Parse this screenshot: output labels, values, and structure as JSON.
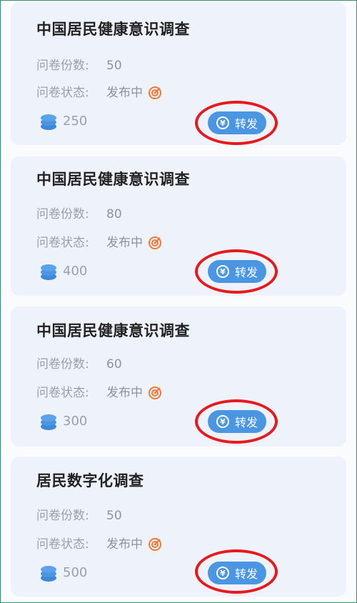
{
  "labels": {
    "count": "问卷份数:",
    "status": "问卷状态:",
    "share": "转发"
  },
  "cards": [
    {
      "title": "中国居民健康意识调查",
      "count": "50",
      "status": "发布中",
      "coins": "250"
    },
    {
      "title": "中国居民健康意识调查",
      "count": "80",
      "status": "发布中",
      "coins": "400"
    },
    {
      "title": "中国居民健康意识调查",
      "count": "60",
      "status": "发布中",
      "coins": "300"
    },
    {
      "title": "居民数字化调查",
      "count": "50",
      "status": "发布中",
      "coins": "500"
    }
  ],
  "colors": {
    "accent": "#4a96e3",
    "highlight_ring": "#e8191c",
    "status_icon": "#f07a35"
  },
  "icons": {
    "status": "target-icon",
    "coins": "coin-stack-icon",
    "share": "yen-circle-icon"
  }
}
